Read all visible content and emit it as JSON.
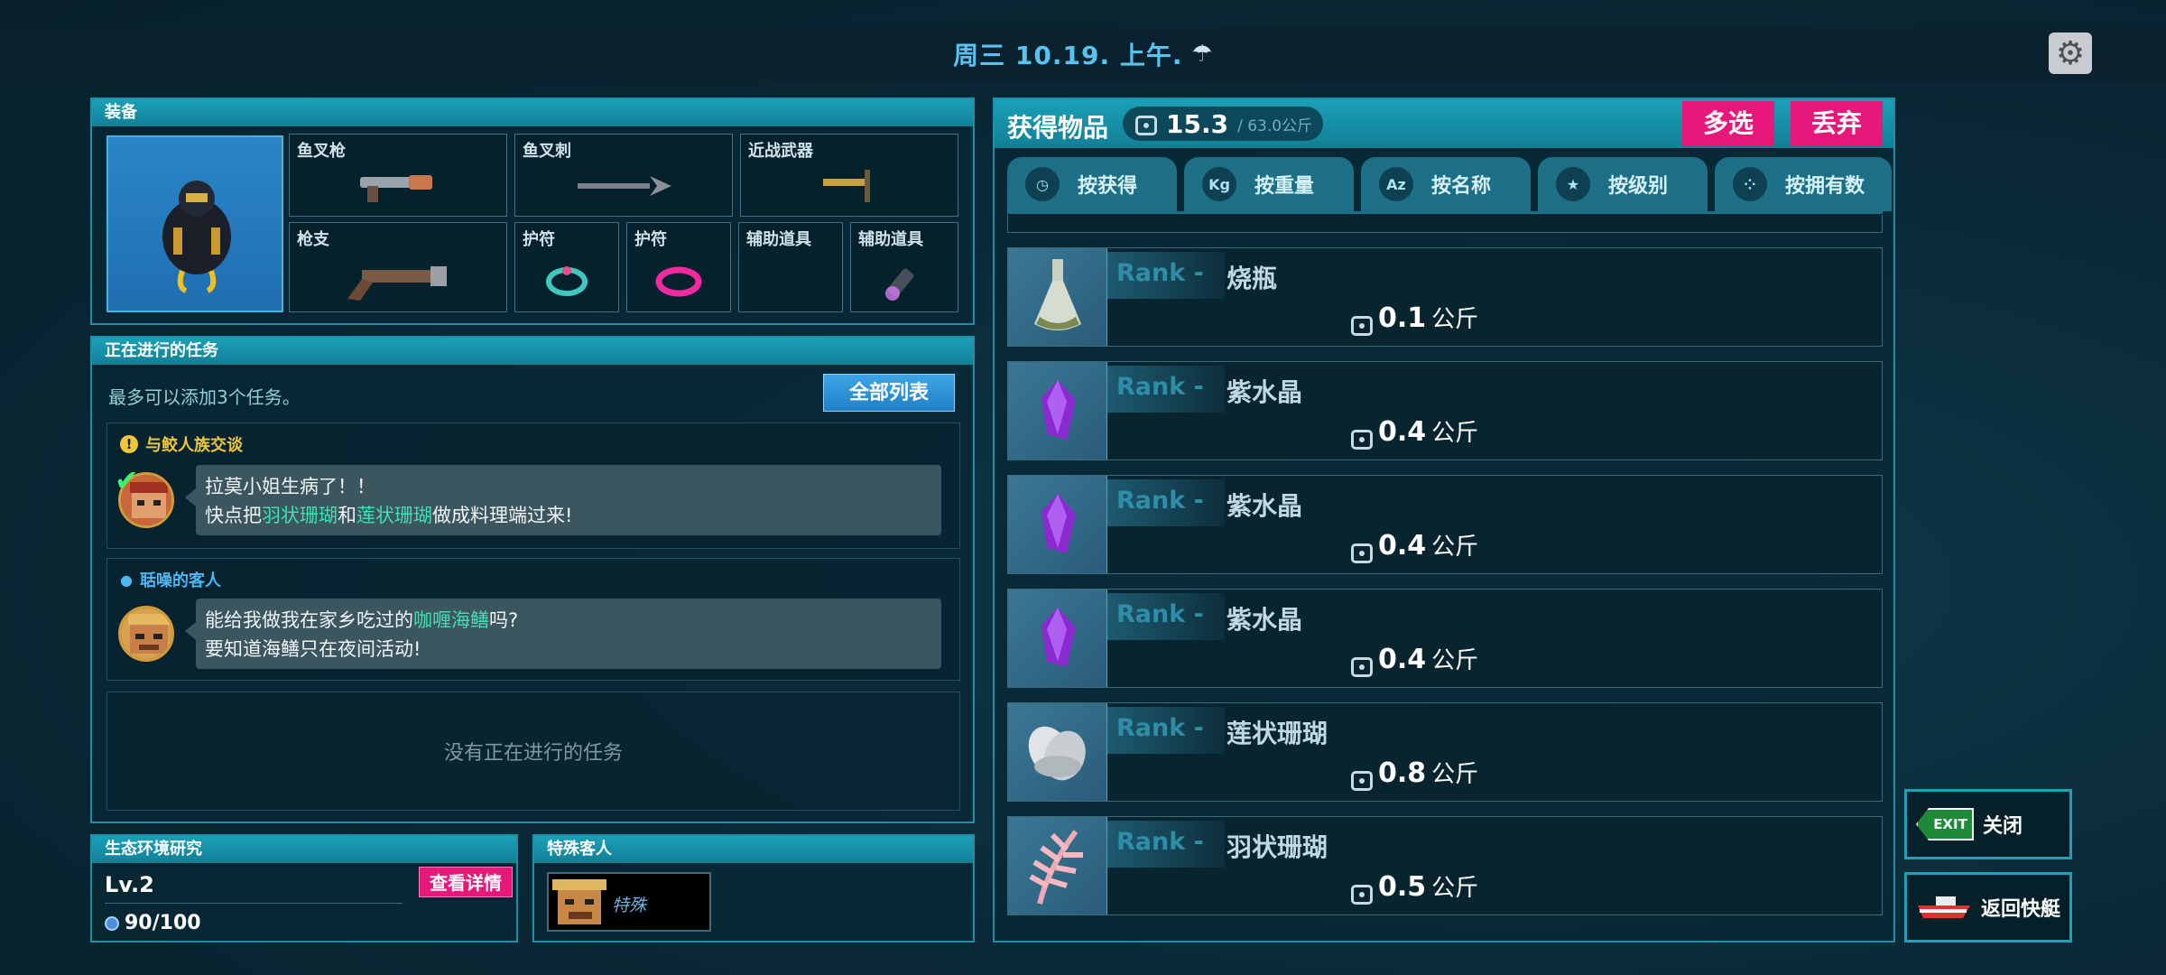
{
  "header": {
    "date": "周三 10.19. 上午.",
    "weather_icon": "rain-cloud-icon",
    "settings_icon": "gear-icon"
  },
  "equipment": {
    "title": "装备",
    "slots": [
      {
        "label": "鱼叉枪",
        "icon": "harpoon-gun-icon"
      },
      {
        "label": "鱼叉刺",
        "icon": "harpoon-spear-icon"
      },
      {
        "label": "近战武器",
        "icon": "pickaxe-icon"
      },
      {
        "label": "枪支",
        "icon": "rifle-icon"
      },
      {
        "label": "护符",
        "icon": "bracelet-icon"
      },
      {
        "label": "护符",
        "icon": "pink-band-icon"
      },
      {
        "label": "辅助道具",
        "icon": ""
      },
      {
        "label": "辅助道具",
        "icon": "flashlight-icon"
      }
    ]
  },
  "quests": {
    "title": "正在进行的任务",
    "hint": "最多可以添加3个任务。",
    "list_button": "全部列表",
    "items": [
      {
        "title": "与鲛人族交谈",
        "line1": "拉莫小姐生病了！！",
        "line2_pre": "快点把",
        "hl1": "羽状珊瑚",
        "mid": "和",
        "hl2": "莲状珊瑚",
        "line2_post": "做成料理端过来!"
      },
      {
        "title": "聒噪的客人",
        "line1_pre": "能给我做我在家乡吃过的",
        "hl1": "咖喱海鳝",
        "line1_post": "吗?",
        "line2": "要知道海鳝只在夜间活动!"
      }
    ],
    "empty_text": "没有正在进行的任务"
  },
  "eco": {
    "title": "生态环境研究",
    "level": "Lv.2",
    "progress": "90/100",
    "detail_button": "查看详情"
  },
  "guest": {
    "title": "特殊客人",
    "tag": "特殊"
  },
  "inventory": {
    "title": "获得物品",
    "weight": "15.3",
    "capacity": "/ 63.0公斤",
    "multi_select": "多选",
    "discard": "丢弃",
    "sort_tabs": [
      {
        "label": "按获得",
        "icon": "clock-icon",
        "glyph": "◷"
      },
      {
        "label": "按重量",
        "icon": "kg-icon",
        "glyph": "Kg"
      },
      {
        "label": "按名称",
        "icon": "az-icon",
        "glyph": "Az"
      },
      {
        "label": "按级别",
        "icon": "star-icon",
        "glyph": "★"
      },
      {
        "label": "按拥有数",
        "icon": "dots-icon",
        "glyph": "⁘"
      }
    ],
    "rank_label": "Rank -",
    "unit": "公斤",
    "items": [
      {
        "name": "烧瓶",
        "weight": "0.1",
        "icon": "flask-icon"
      },
      {
        "name": "紫水晶",
        "weight": "0.4",
        "icon": "amethyst-icon"
      },
      {
        "name": "紫水晶",
        "weight": "0.4",
        "icon": "amethyst-icon"
      },
      {
        "name": "紫水晶",
        "weight": "0.4",
        "icon": "amethyst-icon"
      },
      {
        "name": "莲状珊瑚",
        "weight": "0.8",
        "icon": "lotus-coral-icon"
      },
      {
        "name": "羽状珊瑚",
        "weight": "0.5",
        "icon": "feather-coral-icon"
      }
    ]
  },
  "side_buttons": {
    "close": "关闭",
    "exit_sign": "EXIT",
    "return_boat": "返回快艇"
  }
}
